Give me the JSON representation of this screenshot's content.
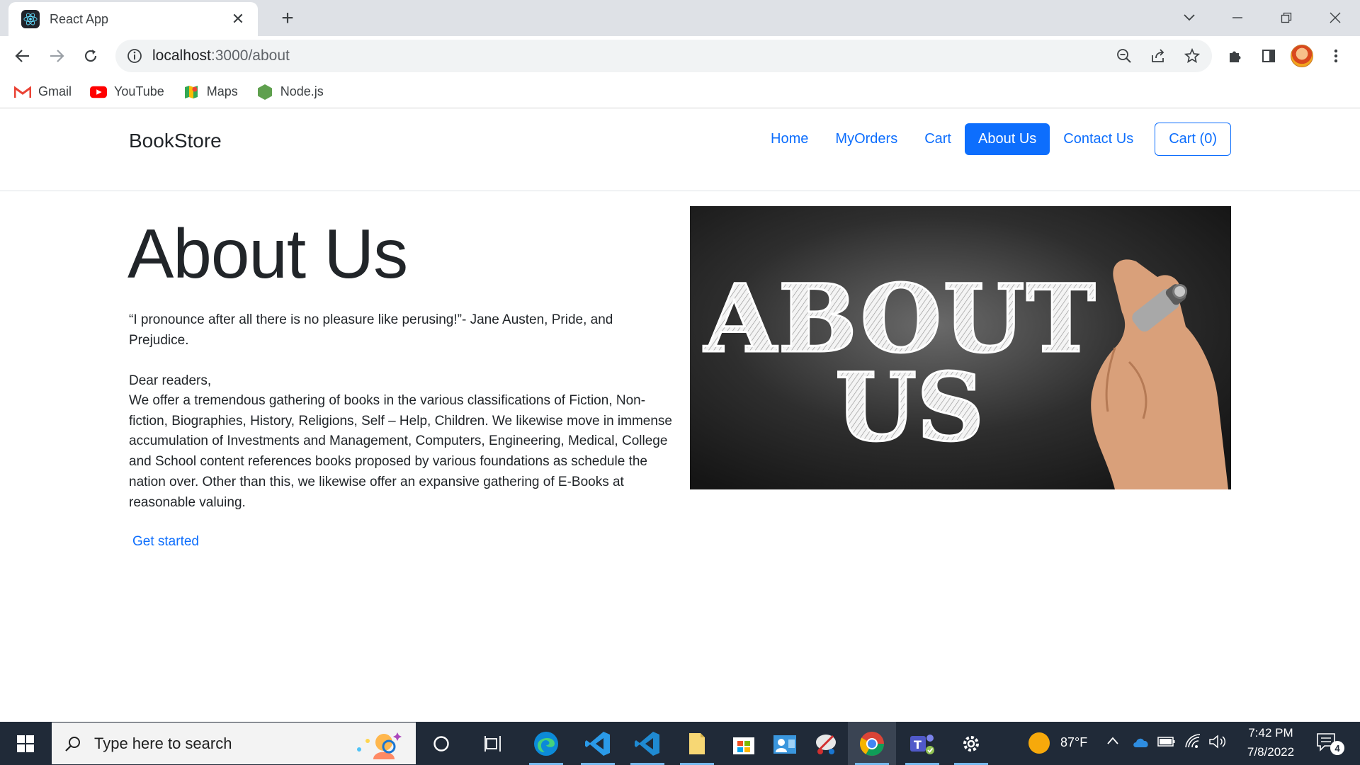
{
  "browser": {
    "tab_title": "React App",
    "url_host": "localhost",
    "url_path": ":3000/about",
    "bookmarks": [
      {
        "label": "Gmail",
        "icon": "gmail-icon"
      },
      {
        "label": "YouTube",
        "icon": "youtube-icon"
      },
      {
        "label": "Maps",
        "icon": "maps-icon"
      },
      {
        "label": "Node.js",
        "icon": "nodejs-icon"
      }
    ]
  },
  "app": {
    "brand": "BookStore",
    "nav": [
      {
        "label": "Home",
        "active": false
      },
      {
        "label": "MyOrders",
        "active": false
      },
      {
        "label": "Cart",
        "active": false
      },
      {
        "label": "About Us",
        "active": true
      },
      {
        "label": "Contact Us",
        "active": false
      }
    ],
    "cart_button": "Cart (0)",
    "accent_color": "#0d6efd"
  },
  "content": {
    "title": "About Us",
    "quote": "“I pronounce after all there is no pleasure like perusing!”- Jane Austen, Pride, and Prejudice.",
    "greeting": "Dear readers,",
    "body": "We offer a tremendous gathering of books in the various classifications of Fiction, Non-fiction, Biographies, History, Religions, Self – Help, Children. We likewise move in immense accumulation of Investments and Management, Computers, Engineering, Medical, College and School content references books proposed by various foundations as schedule the nation over. Other than this, we likewise offer an expansive gathering of E-Books at reasonable valuing.",
    "cta": "Get started",
    "hero_line1": "ABOUT",
    "hero_line2": "US"
  },
  "taskbar": {
    "search_placeholder": "Type here to search",
    "temperature": "87°F",
    "time": "7:42 PM",
    "date": "7/8/2022",
    "notification_count": "4"
  }
}
